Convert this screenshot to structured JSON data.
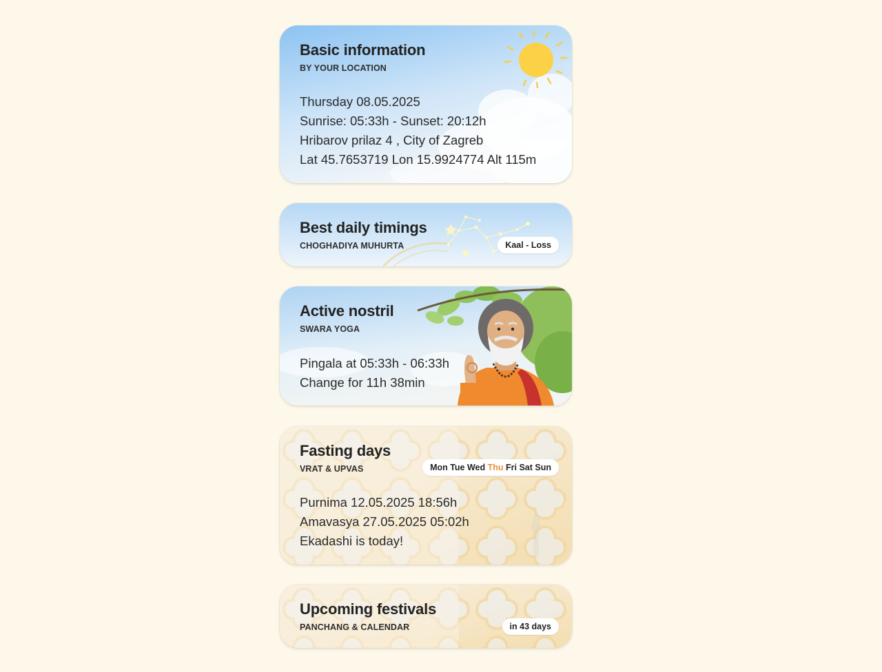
{
  "colors": {
    "page_background": "#fdf8ea",
    "sky_top": "#8cc3f2",
    "sun": "#fdd146",
    "fasting_accent": "#e8903a",
    "pattern_gold": "#f2d39a"
  },
  "cards": [
    {
      "id": "basic-information",
      "title": "Basic information",
      "subtitle": "BY YOUR LOCATION",
      "lines": [
        "Thursday 08.05.2025",
        "Sunrise: 05:33h - Sunset: 20:12h",
        "Hribarov prilaz 4 , City of Zagreb",
        "Lat 45.7653719 Lon 15.9924774 Alt 115m"
      ],
      "icon": "sun-illustration"
    },
    {
      "id": "best-daily-timings",
      "title": "Best daily timings",
      "subtitle": "CHOGHADIYA MUHURTA",
      "badge": "Kaal - Loss",
      "icon": "constellation-illustration"
    },
    {
      "id": "active-nostril",
      "title": "Active nostril",
      "subtitle": "SWARA YOGA",
      "lines": [
        "Pingala at 05:33h - 06:33h",
        "Change for 11h 38min"
      ],
      "icon": "yogi-illustration"
    },
    {
      "id": "fasting-days",
      "title": "Fasting days",
      "subtitle": "VRAT & UPVAS",
      "weekdays": {
        "before": "Mon Tue Wed ",
        "active": "Thu",
        "after": " Fri Sat Sun"
      },
      "lines": [
        "Purnima 12.05.2025 18:56h",
        "Amavasya 27.05.2025 05:02h",
        "Ekadashi is today!"
      ],
      "icon": "temple-pattern-illustration"
    },
    {
      "id": "upcoming-festivals",
      "title": "Upcoming festivals",
      "subtitle": "PANCHANG & CALENDAR",
      "badge": "in 43 days",
      "icon": "temple-pattern-illustration"
    }
  ]
}
